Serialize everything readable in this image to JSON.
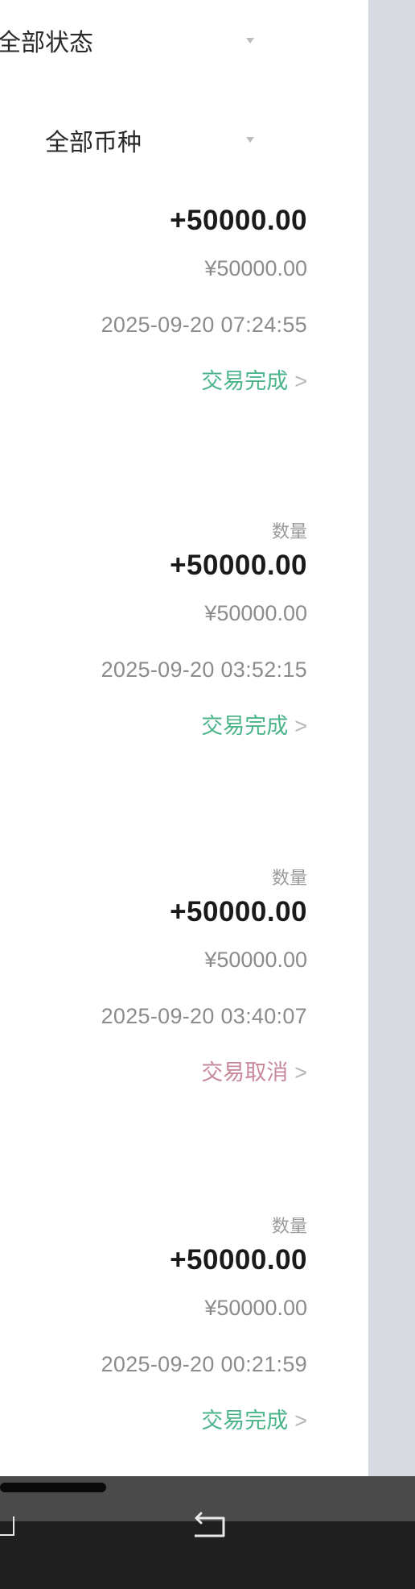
{
  "filters": {
    "status": "全部状态",
    "currency": "全部币种"
  },
  "records": [
    {
      "label": "",
      "amount": "+50000.00",
      "fiat": "¥50000.00",
      "time": "2025-09-20 07:24:55",
      "status": "交易完成",
      "status_color": "#4cb48a"
    },
    {
      "label": "数量",
      "amount": "+50000.00",
      "fiat": "¥50000.00",
      "time": "2025-09-20 03:52:15",
      "status": "交易完成",
      "status_color": "#4cb48a"
    },
    {
      "label": "数量",
      "amount": "+50000.00",
      "fiat": "¥50000.00",
      "time": "2025-09-20 03:40:07",
      "status": "交易取消",
      "status_color": "#c7899a"
    },
    {
      "label": "数量",
      "amount": "+50000.00",
      "fiat": "¥50000.00",
      "time": "2025-09-20 00:21:59",
      "status": "交易完成",
      "status_color": "#4cb48a"
    }
  ],
  "chevron": ">",
  "icons": {
    "filter_caret": "caret-down-icon",
    "nav_home": "home-icon",
    "nav_back": "back-icon"
  }
}
